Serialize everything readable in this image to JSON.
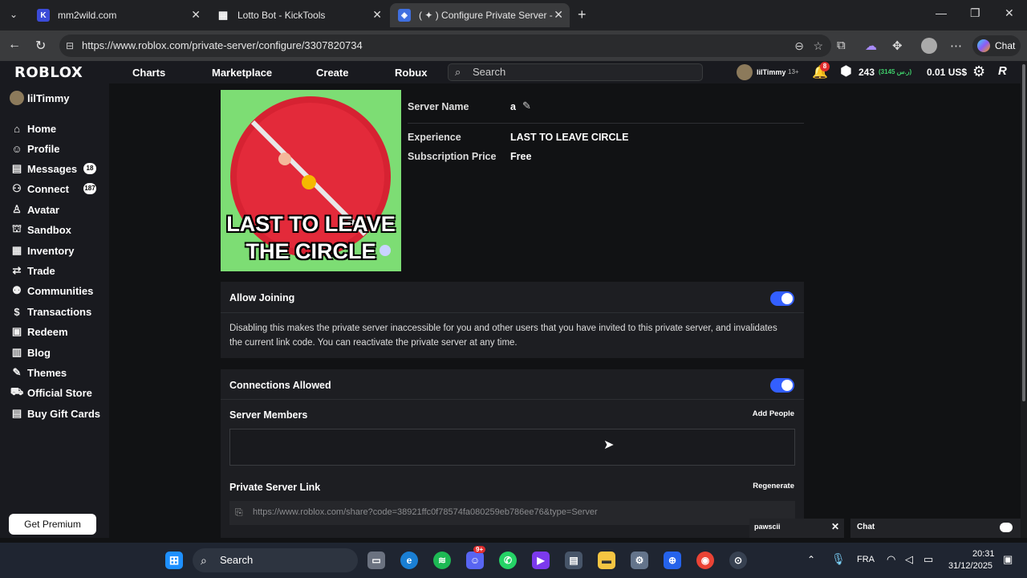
{
  "browser": {
    "tabs": [
      {
        "title": "mm2wild.com",
        "active": false
      },
      {
        "title": "Lotto Bot - KickTools",
        "active": false
      },
      {
        "title": "( ✦ ) Configure Private Server - Ro",
        "active": true
      }
    ],
    "url": "https://www.roblox.com/private-server/configure/3307820734",
    "chat_label": "Chat"
  },
  "topnav": {
    "logo": "ROBLOX",
    "links": [
      "Charts",
      "Marketplace",
      "Create",
      "Robux"
    ],
    "search_placeholder": "Search",
    "username": "lilTimmy",
    "age_tag": "13+",
    "notifications": "8",
    "robux": "243",
    "robux_pending": "(3145 ر.س)",
    "currency": "0.01 US$"
  },
  "sidebar": {
    "user": "lilTimmy",
    "items": [
      {
        "label": "Home",
        "icon": "home-icon",
        "glyph": "⌂"
      },
      {
        "label": "Profile",
        "icon": "profile-icon",
        "glyph": "☺"
      },
      {
        "label": "Messages",
        "icon": "messages-icon",
        "glyph": "▤",
        "badge": "18"
      },
      {
        "label": "Connect",
        "icon": "connect-icon",
        "glyph": "⚇",
        "badge": "187"
      },
      {
        "label": "Avatar",
        "icon": "avatar-icon",
        "glyph": "♙"
      },
      {
        "label": "Sandbox",
        "icon": "sandbox-icon",
        "glyph": "⛫"
      },
      {
        "label": "Inventory",
        "icon": "inventory-icon",
        "glyph": "▦"
      },
      {
        "label": "Trade",
        "icon": "trade-icon",
        "glyph": "⇄"
      },
      {
        "label": "Communities",
        "icon": "communities-icon",
        "glyph": "⚉"
      },
      {
        "label": "Transactions",
        "icon": "transactions-icon",
        "glyph": "$"
      },
      {
        "label": "Redeem",
        "icon": "redeem-icon",
        "glyph": "▣"
      },
      {
        "label": "Blog",
        "icon": "blog-icon",
        "glyph": "▥"
      },
      {
        "label": "Themes",
        "icon": "themes-icon",
        "glyph": "✎"
      },
      {
        "label": "Official Store",
        "icon": "store-icon",
        "glyph": "⛟"
      },
      {
        "label": "Buy Gift Cards",
        "icon": "gift-card-icon",
        "glyph": "▤"
      }
    ],
    "premium_button": "Get Premium"
  },
  "server": {
    "thumbnail_text_1": "LAST TO LEAVE",
    "thumbnail_text_2": "THE CIRCLE",
    "name_label": "Server Name",
    "name_value": "a",
    "experience_label": "Experience",
    "experience_value": "LAST TO LEAVE CIRCLE",
    "price_label": "Subscription Price",
    "price_value": "Free"
  },
  "allow_joining": {
    "title": "Allow Joining",
    "enabled": true,
    "description": "Disabling this makes the private server inaccessible for you and other users that you have invited to this private server, and invalidates the current link code. You can reactivate the private server at any time."
  },
  "members": {
    "connections_label": "Connections Allowed",
    "connections_enabled": true,
    "server_members_label": "Server Members",
    "add_people": "Add People",
    "link_label": "Private Server Link",
    "regenerate": "Regenerate",
    "link_value": "https://www.roblox.com/share?code=38921ffc0f78574fa080259eb786ee76&type=Server"
  },
  "overlays": {
    "chat_user": "pawscii",
    "chat_label": "Chat"
  },
  "taskbar": {
    "search": "Search",
    "language": "FRA",
    "time": "20:31",
    "date": "31/12/2025",
    "discord_badge": "9+"
  },
  "colors": {
    "accent": "#335fff",
    "background": "#111214",
    "panel": "#1d1e22",
    "thumbnail_bg": "#7ddd74",
    "circle_red": "#d62232"
  }
}
